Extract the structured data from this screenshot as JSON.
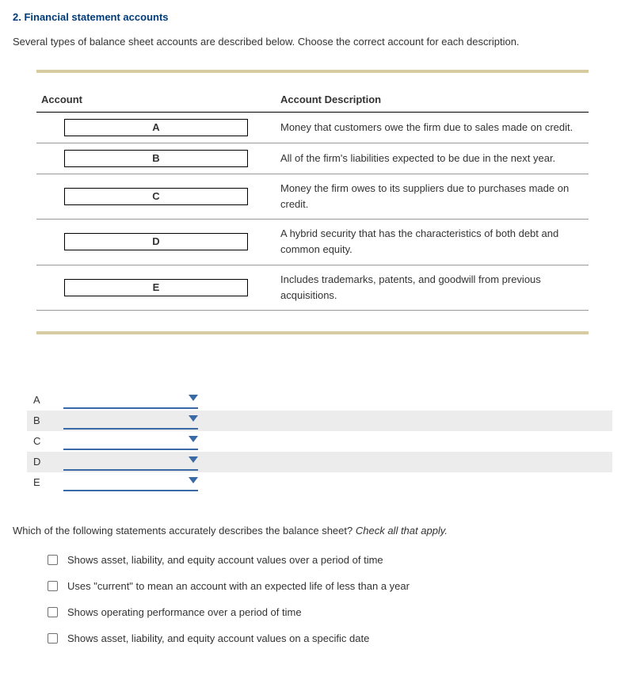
{
  "title": "2. Financial statement accounts",
  "intro": "Several types of balance sheet accounts are described below. Choose the correct account for each description.",
  "table": {
    "head_account": "Account",
    "head_desc": "Account Description",
    "rows": [
      {
        "slot": "A",
        "desc": "Money that customers owe the firm due to sales made on credit."
      },
      {
        "slot": "B",
        "desc": "All of the firm's liabilities expected to be due in the next year."
      },
      {
        "slot": "C",
        "desc": "Money the firm owes to its suppliers due to purchases made on credit."
      },
      {
        "slot": "D",
        "desc": "A hybrid security that has the characteristics of both debt and common equity."
      },
      {
        "slot": "E",
        "desc": "Includes trademarks, patents, and goodwill from previous acquisitions."
      }
    ]
  },
  "answers": [
    {
      "label": "A"
    },
    {
      "label": "B"
    },
    {
      "label": "C"
    },
    {
      "label": "D"
    },
    {
      "label": "E"
    }
  ],
  "question2": {
    "text": "Which of the following statements accurately describes the balance sheet? ",
    "instruction": "Check all that apply."
  },
  "options": [
    "Shows asset, liability, and equity account values over a period of time",
    "Uses \"current\" to mean an account with an expected life of less than a year",
    "Shows operating performance over a period of time",
    "Shows asset, liability, and equity account values on a specific date"
  ]
}
